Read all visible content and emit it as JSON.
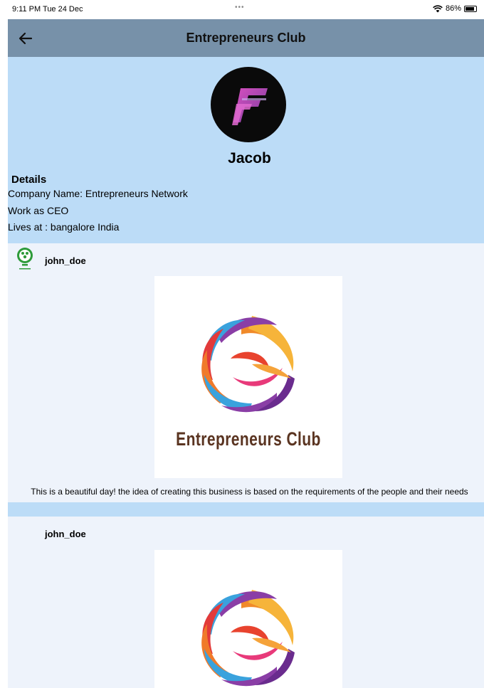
{
  "status_bar": {
    "time": "9:11 PM  Tue 24 Dec",
    "dots": "•••",
    "battery": "86%"
  },
  "nav": {
    "title": "Entrepreneurs Club",
    "back_icon": "arrow-left-icon"
  },
  "profile": {
    "name": "Jacob",
    "details_heading": "Details",
    "company": "Company Name: Entrepreneurs Network",
    "work": "Work as CEO",
    "lives": " Lives at : bangalore India"
  },
  "posts": [
    {
      "username": "john_doe",
      "image_text": "Entrepreneurs Club",
      "caption": "This is a beautiful day! the idea of creating this business is based on the requirements of the people and their needs"
    },
    {
      "username": "john_doe"
    }
  ],
  "colors": {
    "nav": "#7791a9",
    "profile_bg": "#bcdcf7",
    "feed_bg": "#eef3fb"
  }
}
